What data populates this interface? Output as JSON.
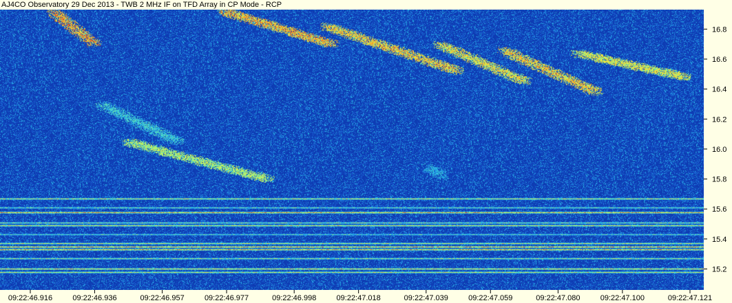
{
  "chart_data": {
    "type": "heatmap",
    "title": "AJ4CO Observatory 29 Dec 2013 - TWB 2 MHz IF on TFD Array in CP Mode - RCP",
    "xlabel": "",
    "ylabel": "",
    "x_ticks": [
      "09:22:46.916",
      "09:22:46.936",
      "09:22:46.957",
      "09:22:46.977",
      "09:22:46.998",
      "09:22:47.018",
      "09:22:47.039",
      "09:22:47.059",
      "09:22:47.080",
      "09:22:47.100",
      "09:22:47.121"
    ],
    "y_ticks": [
      15.2,
      15.4,
      15.6,
      15.8,
      16.0,
      16.2,
      16.4,
      16.6,
      16.8
    ],
    "ylim": [
      15.06,
      16.93
    ],
    "y_log_scale": false,
    "colormap": [
      "#0a2fa8",
      "#1e6fe0",
      "#29c4e8",
      "#8ef08a",
      "#f2f03a",
      "#f29a2a",
      "#e03a20"
    ],
    "horizontal_bands": [
      {
        "freq": 15.18,
        "intensity": 0.7
      },
      {
        "freq": 15.2,
        "intensity": 0.8
      },
      {
        "freq": 15.27,
        "intensity": 0.6
      },
      {
        "freq": 15.33,
        "intensity": 0.9
      },
      {
        "freq": 15.35,
        "intensity": 0.95
      },
      {
        "freq": 15.37,
        "intensity": 0.7
      },
      {
        "freq": 15.43,
        "intensity": 0.45
      },
      {
        "freq": 15.49,
        "intensity": 0.75
      },
      {
        "freq": 15.51,
        "intensity": 0.55
      },
      {
        "freq": 15.58,
        "intensity": 0.9
      },
      {
        "freq": 15.61,
        "intensity": 0.5
      },
      {
        "freq": 15.67,
        "intensity": 0.7
      }
    ],
    "bursts": [
      {
        "t0": "09:22:46.923",
        "t1": "09:22:46.936",
        "f0": 16.92,
        "f1": 16.7,
        "intensity": 0.9
      },
      {
        "t0": "09:22:46.946",
        "t1": "09:22:46.990",
        "f0": 16.05,
        "f1": 15.8,
        "intensity": 0.6
      },
      {
        "t0": "09:22:46.938",
        "t1": "09:22:46.962",
        "f0": 16.3,
        "f1": 16.05,
        "intensity": 0.4
      },
      {
        "t0": "09:22:46.976",
        "t1": "09:22:47.010",
        "f0": 16.92,
        "f1": 16.7,
        "intensity": 0.85
      },
      {
        "t0": "09:22:47.008",
        "t1": "09:22:47.049",
        "f0": 16.82,
        "f1": 16.52,
        "intensity": 0.8
      },
      {
        "t0": "09:22:47.043",
        "t1": "09:22:47.070",
        "f0": 16.7,
        "f1": 16.45,
        "intensity": 0.75
      },
      {
        "t0": "09:22:47.063",
        "t1": "09:22:47.092",
        "f0": 16.66,
        "f1": 16.38,
        "intensity": 0.8
      },
      {
        "t0": "09:22:47.086",
        "t1": "09:22:47.120",
        "f0": 16.64,
        "f1": 16.48,
        "intensity": 0.7
      },
      {
        "t0": "09:22:47.040",
        "t1": "09:22:47.044",
        "f0": 15.88,
        "f1": 15.82,
        "intensity": 0.35
      }
    ]
  }
}
